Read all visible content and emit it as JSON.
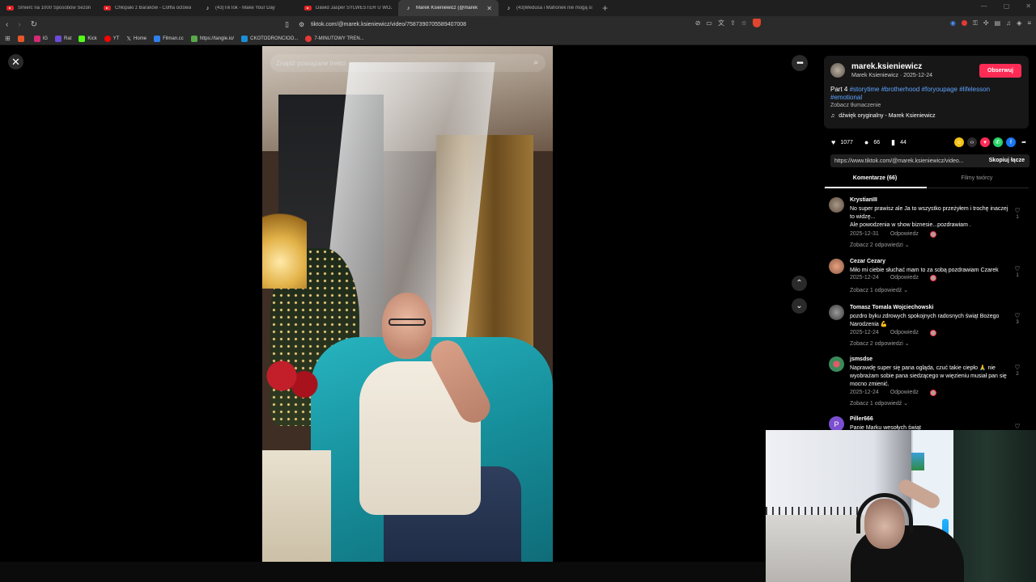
{
  "tabs": [
    {
      "icon": "youtube",
      "label": "Śmierć na 1000 Sposobów Sezon 3 | ",
      "active": false
    },
    {
      "icon": "youtube",
      "label": "Chłopaki z Baraków - Coffla octowa - Y",
      "active": false
    },
    {
      "icon": "tiktok",
      "label": "(43)TikTok - Make Your Day",
      "active": false
    },
    {
      "icon": "youtube",
      "label": "Dawid Jasper SYLWESTER U WÓJCIK",
      "active": false
    },
    {
      "icon": "tiktok",
      "label": "Marek Ksieniewicz (@marek.k",
      "active": true
    },
    {
      "icon": "tiktok",
      "label": "(43)Medusa i Mahonek nie mogą się",
      "active": false
    }
  ],
  "address": {
    "url": "tiktok.com/@marek.ksieniewicz/video/7587390705589407008"
  },
  "bookmarks": [
    {
      "label": "",
      "color": "#e8562a"
    },
    {
      "label": "IG",
      "color": "#d62976"
    },
    {
      "label": "Rat",
      "color": "#6c4bd8"
    },
    {
      "label": "Kick",
      "color": "#53fc18"
    },
    {
      "label": "YT",
      "color": "#ff0000"
    },
    {
      "label": "Home",
      "color": "#ffffff"
    },
    {
      "label": "Filman.cc",
      "color": "#2f80ed"
    },
    {
      "label": "https://tangle.io/",
      "color": "#59a84a"
    },
    {
      "label": "CKOTODRONCIOO...",
      "color": "#1b8fd6"
    },
    {
      "label": "7-MINUTOWY TREN...",
      "color": "#e53935"
    }
  ],
  "video": {
    "search_placeholder": "Znajdź powiązane treści"
  },
  "panel": {
    "username": "marek.ksieniewicz",
    "subline": "Marek Ksieniewicz · 2025-12-24",
    "follow_label": "Obserwuj",
    "desc_prefix": "Part 4 ",
    "hashtags": "#storytime #brotherhood #foryoupage #lifelesson #emotional",
    "translate": "Zobacz tłumaczenie",
    "sound": "dźwięk oryginalny - Marek Ksieniewicz",
    "likes": "1077",
    "comments": "66",
    "saves": "44",
    "link": "https://www.tiktok.com/@marek.ksieniewicz/video...",
    "copy_label": "Skopiuj łącze",
    "tab_comments": "Komentarze (66)",
    "tab_creator": "Filmy twórcy"
  },
  "comments": [
    {
      "name": "KrystianIII",
      "text": "No super prawisz ale Ja to wszystko przeżyłem i trochę inaczej to widzę...",
      "text2": "Ale powodzenia w show biznesie...pozdrawiam .",
      "date": "2025-12-31",
      "reply": "Odpowiedz",
      "replies": "Zobacz 2 odpowiedzi ⌄",
      "likes": "1",
      "avatar": "#8a7a6a"
    },
    {
      "name": "Cezar Cezary",
      "text": "Miło mi ciebie słuchać mam to za sobą pozdrawiam Czarek",
      "text2": "",
      "date": "2025-12-24",
      "reply": "Odpowiedz",
      "replies": "Zobacz 1 odpowiedź ⌄",
      "likes": "1",
      "avatar": "#c88a66"
    },
    {
      "name": "Tomasz Tomala Wojciechowski",
      "text": "pozdro byku zdrowych spokojnych radosnych świąt Bożego Narodzenia 💪",
      "text2": "",
      "date": "2025-12-24",
      "reply": "Odpowiedz",
      "replies": "Zobacz 2 odpowiedzi ⌄",
      "likes": "3",
      "avatar": "#5a5a5a"
    },
    {
      "name": "jsmsdse",
      "text": "Naprawdę super się pana ogląda, czuć takie ciepło 🙏 nie wyobrażam sobie pana siedzącego w więzieniu musiał pan się mocno zmienić.",
      "text2": "",
      "date": "2025-12-24",
      "reply": "Odpowiedz",
      "replies": "Zobacz 1 odpowiedź ⌄",
      "likes": "2",
      "avatar": "#3a8a5a"
    },
    {
      "name": "Piller666",
      "text": "Panie Marku wesołych świąt",
      "text2": "",
      "date": "",
      "reply": "",
      "replies": "",
      "likes": "",
      "avatar": "#7b4fd0",
      "initial": "P"
    }
  ],
  "colors": {
    "accent": "#fe2c55",
    "hashtag": "#5ea4ff",
    "panel_bg": "#171717"
  }
}
